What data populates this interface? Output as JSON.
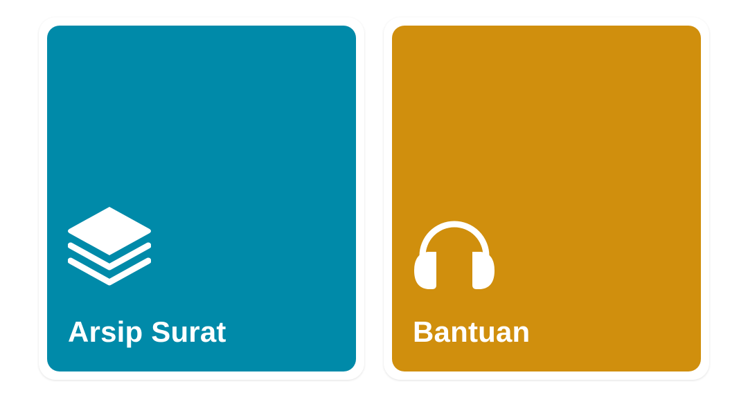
{
  "menu": {
    "tiles": [
      {
        "label": "Arsip Surat",
        "icon": "layers-icon",
        "color": "#008aa9"
      },
      {
        "label": "Bantuan",
        "icon": "headphones-icon",
        "color": "#d08f0d"
      }
    ]
  }
}
